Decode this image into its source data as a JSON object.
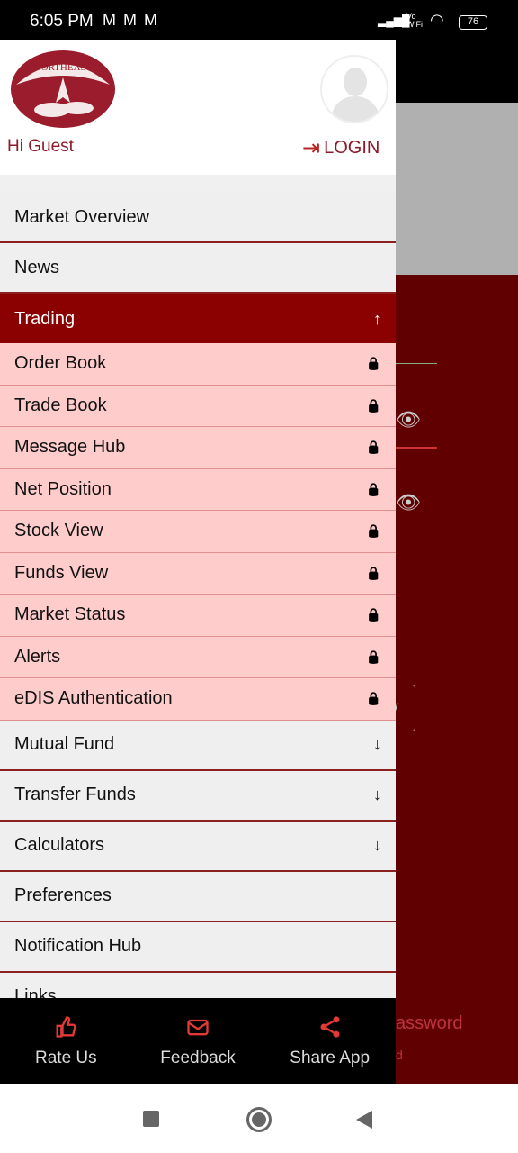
{
  "status": {
    "time": "6:05 PM",
    "notif_icons": [
      "gmail-icon",
      "gmail-icon",
      "gmail-icon"
    ],
    "network": "Vo WiFi",
    "battery": "76"
  },
  "header": {
    "logo_text": "NORTHEAST",
    "greeting": "Hi Guest",
    "login_label": "LOGIN"
  },
  "menu": [
    {
      "label": "Market Overview"
    },
    {
      "label": "News"
    },
    {
      "label": "Trading",
      "expanded": true,
      "icon": "arrow-up-icon"
    }
  ],
  "trading_items": [
    {
      "label": "Order Book",
      "icon": "lock-icon"
    },
    {
      "label": "Trade Book",
      "icon": "lock-icon"
    },
    {
      "label": "Message Hub",
      "icon": "lock-icon"
    },
    {
      "label": "Net Position",
      "icon": "lock-icon"
    },
    {
      "label": "Stock View",
      "icon": "lock-icon"
    },
    {
      "label": "Funds View",
      "icon": "lock-icon"
    },
    {
      "label": "Market Status",
      "icon": "lock-icon"
    },
    {
      "label": "Alerts",
      "icon": "lock-icon"
    },
    {
      "label": "eDIS Authentication",
      "icon": "lock-icon"
    }
  ],
  "menu2": [
    {
      "label": "Mutual Fund",
      "icon": "arrow-down-icon"
    },
    {
      "label": "Transfer Funds",
      "icon": "arrow-down-icon"
    },
    {
      "label": "Calculators",
      "icon": "arrow-down-icon"
    },
    {
      "label": "Preferences"
    },
    {
      "label": "Notification Hub"
    },
    {
      "label": "Links"
    }
  ],
  "bottom": [
    {
      "label": "Rate Us",
      "icon": "thumbs-up-icon"
    },
    {
      "label": "Feedback",
      "icon": "mail-icon"
    },
    {
      "label": "Share App",
      "icon": "share-icon"
    }
  ],
  "background": {
    "button_text": "w",
    "password_text": "assword",
    "small_text": "d"
  },
  "colors": {
    "accent": "#8b0000",
    "submenu_bg": "#ffcccc",
    "icon_red": "#e53935"
  }
}
